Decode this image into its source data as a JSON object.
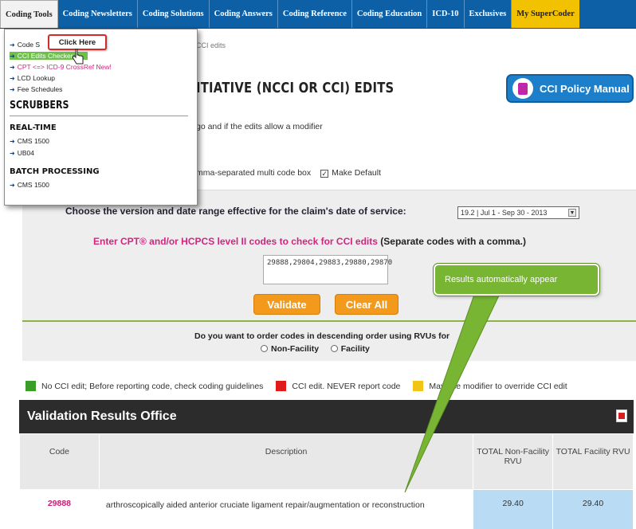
{
  "topnav": {
    "tabs": [
      {
        "label": "Coding Tools"
      },
      {
        "label": "Coding Newsletters"
      },
      {
        "label": "Coding Solutions"
      },
      {
        "label": "Coding Answers"
      },
      {
        "label": "Coding Reference"
      },
      {
        "label": "Coding Education"
      },
      {
        "label": "ICD-10"
      },
      {
        "label": "Exclusives"
      },
      {
        "label": "My SuperCoder"
      }
    ]
  },
  "menu": {
    "items": [
      {
        "label": "Code S"
      },
      {
        "label": "CCI Edits Checker"
      },
      {
        "label": "CPT <=> ICD-9 CrossRef New!"
      },
      {
        "label": "LCD Lookup"
      },
      {
        "label": "Fee Schedules"
      }
    ],
    "scrubbers_heading": "SCRUBBERS",
    "realtime_heading": "REAL-TIME",
    "realtime_items": [
      {
        "label": "CMS 1500"
      },
      {
        "label": "UB04"
      }
    ],
    "batch_heading": "BATCH PROCESSING",
    "batch_items": [
      {
        "label": "CMS 1500"
      }
    ],
    "click_here": "Click Here"
  },
  "page": {
    "breadcrumb": "CCI edits",
    "title": "ITIATIVE (NCCI OR CCI) EDITS",
    "policy_button": "CCI Policy Manual",
    "edit_text": "go and if the edits allow a modifier",
    "multi_text": "mma-separated multi code box",
    "make_default": "Make Default"
  },
  "form": {
    "version_prompt": "Choose the version and date range effective for the claim's date of service:",
    "version_selected": "19.2 | Jul 1 - Sep 30 - 2013",
    "enter_prompt": "Enter CPT® and/or HCPCS level II codes to check for CCI edits",
    "enter_note": " (Separate codes with a comma.)",
    "codes_value": "29888,29804,29883,29880,29870",
    "validate_label": "Validate",
    "clear_label": "Clear All",
    "order_prompt": "Do you want to order codes in descending order using RVUs for",
    "nonfacility_label": "Non-Facility",
    "facility_label": "Facility"
  },
  "legend": [
    {
      "label": "No CCI edit; Before reporting code, check coding guidelines",
      "color": "#3a9d28"
    },
    {
      "label": "CCI edit. NEVER report code",
      "color": "#e01b1b"
    },
    {
      "label": "May use modifier to override CCI edit",
      "color": "#f2c414"
    }
  ],
  "results": {
    "title": "Validation Results Office",
    "columns": [
      "Code",
      "Description",
      "TOTAL Non-Facility RVU",
      "TOTAL Facility RVU"
    ],
    "rows": [
      {
        "code": "29888",
        "description": "arthroscopically aided anterior cruciate ligament repair/augmentation or reconstruction",
        "nonfacility": "29.40",
        "facility": "29.40"
      }
    ]
  },
  "callout": "Results automatically appear",
  "colors": {
    "nav": "#0d5fa6",
    "accent_orange": "#f39a1c",
    "callout_green": "#77b533",
    "code_pink": "#c51f73"
  }
}
